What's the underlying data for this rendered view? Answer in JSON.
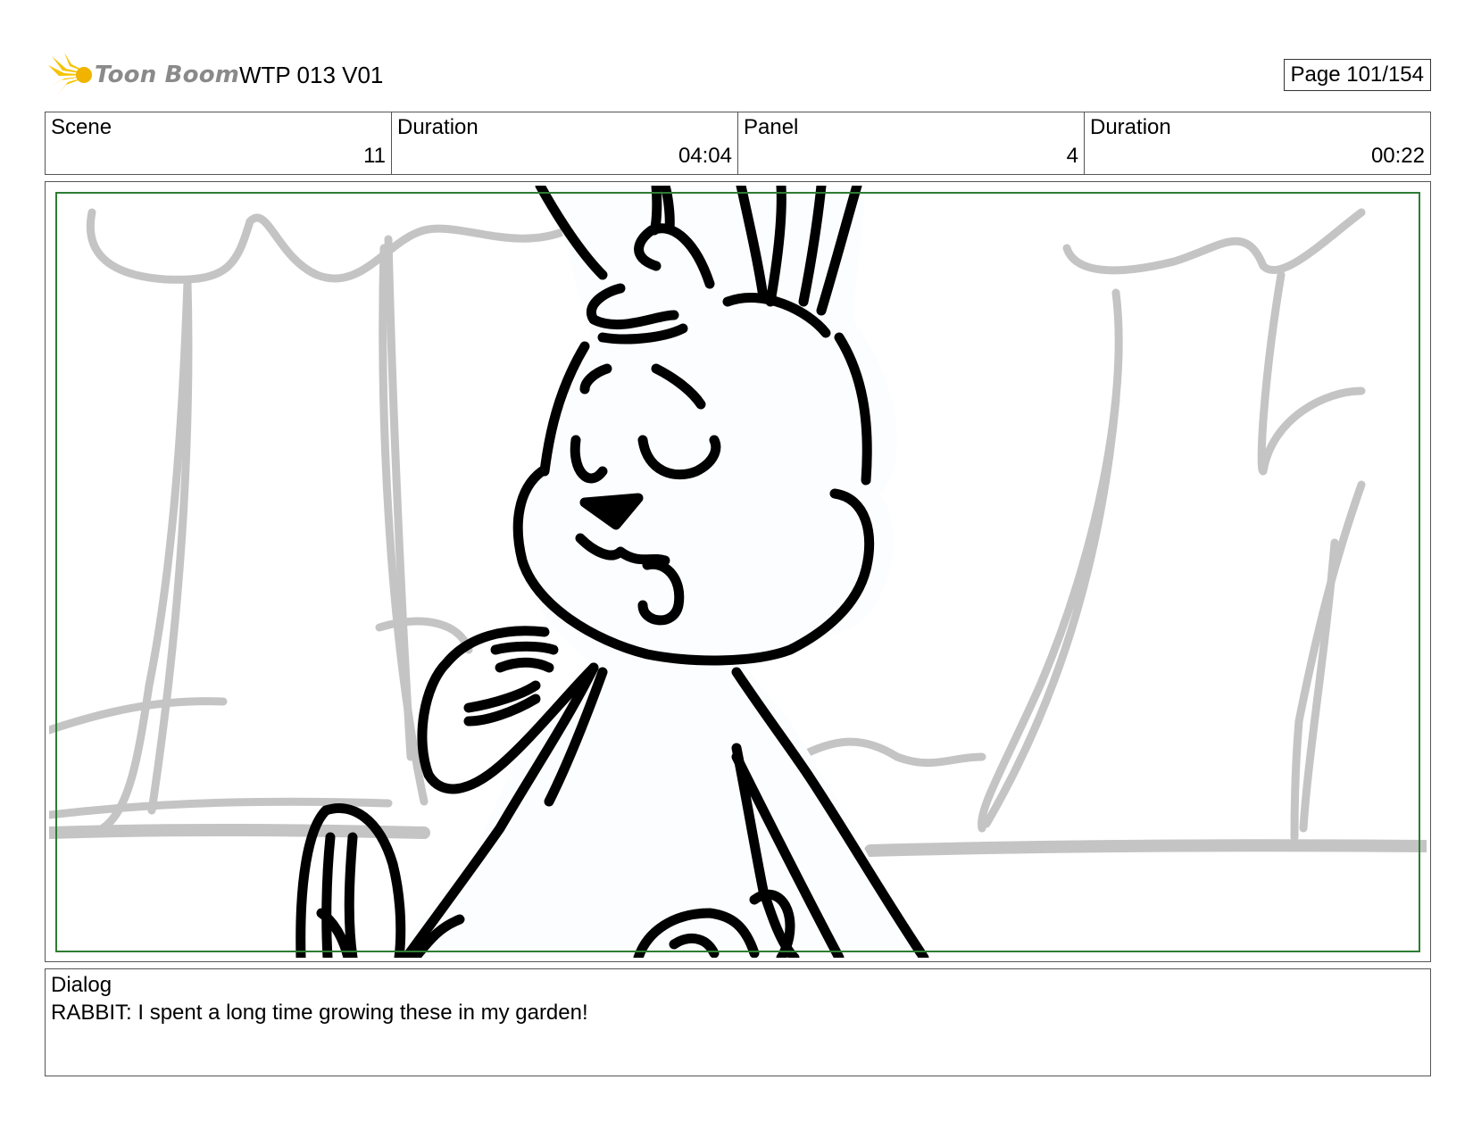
{
  "header": {
    "logo_text": "Toon Boom",
    "project": "WTP 013 V01",
    "page": "Page 101/154"
  },
  "info": {
    "scene_label": "Scene",
    "scene_value": "11",
    "scene_duration_label": "Duration",
    "scene_duration_value": "04:04",
    "panel_label": "Panel",
    "panel_value": "4",
    "panel_duration_label": "Duration",
    "panel_duration_value": "00:22"
  },
  "dialog": {
    "label": "Dialog",
    "text": "RABBIT: I spent a long time growing these in my garden!"
  },
  "colors": {
    "safe_frame": "#2e7d32",
    "sketch_gray": "#c4c4c4",
    "logo_yellow": "#f5c400",
    "ink": "#000000"
  },
  "icons": {
    "logo": "toon-boom-burst-icon"
  }
}
